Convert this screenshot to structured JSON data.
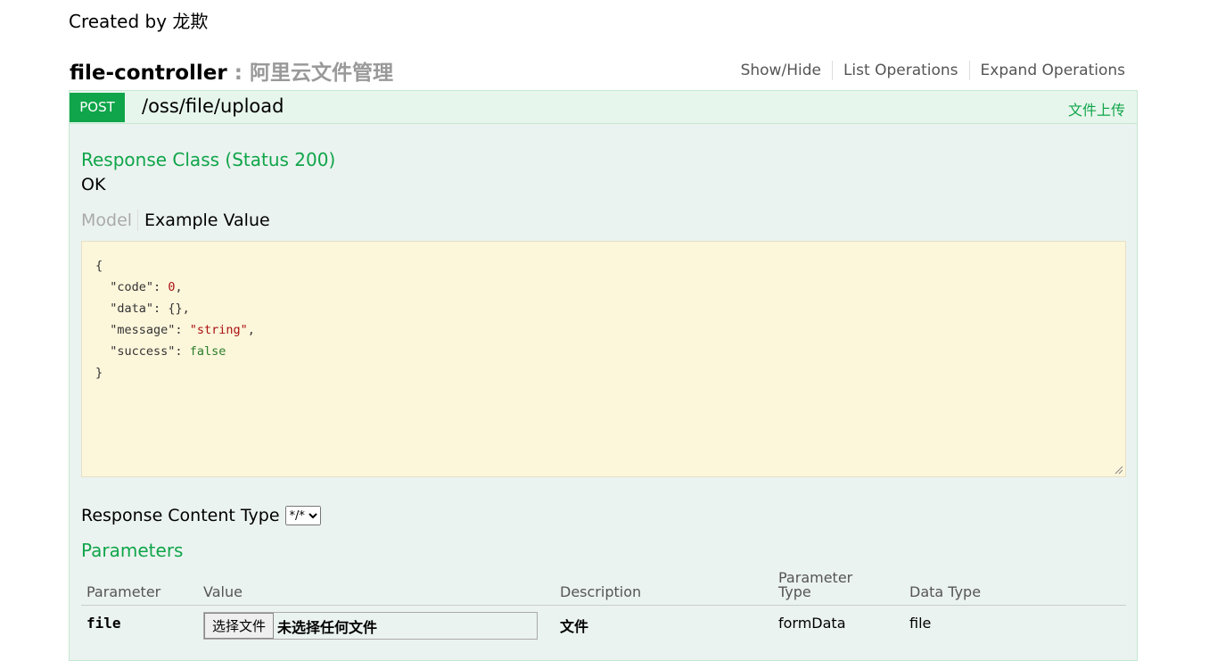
{
  "page": {
    "created_by": "Created by 龙欺"
  },
  "resource": {
    "name": "file-controller",
    "description": ": 阿里云文件管理",
    "actions": [
      "Show/Hide",
      "List Operations",
      "Expand Operations"
    ]
  },
  "operation": {
    "method": "POST",
    "path": "/oss/file/upload",
    "summary": "文件上传",
    "response_class_title": "Response Class (Status 200)",
    "response_class_value": "OK",
    "tabs": {
      "model": "Model",
      "example": "Example Value"
    },
    "example_json": {
      "open": "{",
      "close": "}",
      "lines": [
        {
          "key": "\"code\"",
          "value": "0",
          "kind": "num",
          "comma": ","
        },
        {
          "key": "\"data\"",
          "value": "{}",
          "kind": "plain",
          "comma": ","
        },
        {
          "key": "\"message\"",
          "value": "\"string\"",
          "kind": "str",
          "comma": ","
        },
        {
          "key": "\"success\"",
          "value": "false",
          "kind": "bool",
          "comma": ""
        }
      ]
    },
    "response_content_type_label": "Response Content Type",
    "response_content_type_value": "*/*",
    "parameters_title": "Parameters",
    "param_headers": [
      "Parameter",
      "Value",
      "Description",
      "Parameter Type",
      "Data Type"
    ],
    "params": [
      {
        "name": "file",
        "button": "选择文件",
        "no_file": "未选择任何文件",
        "description": "文件",
        "param_type": "formData",
        "data_type": "file"
      }
    ]
  },
  "colors": {
    "method_post": "#10a54a",
    "op_bg": "#ebf3f0",
    "code_bg": "#fcf6db"
  }
}
